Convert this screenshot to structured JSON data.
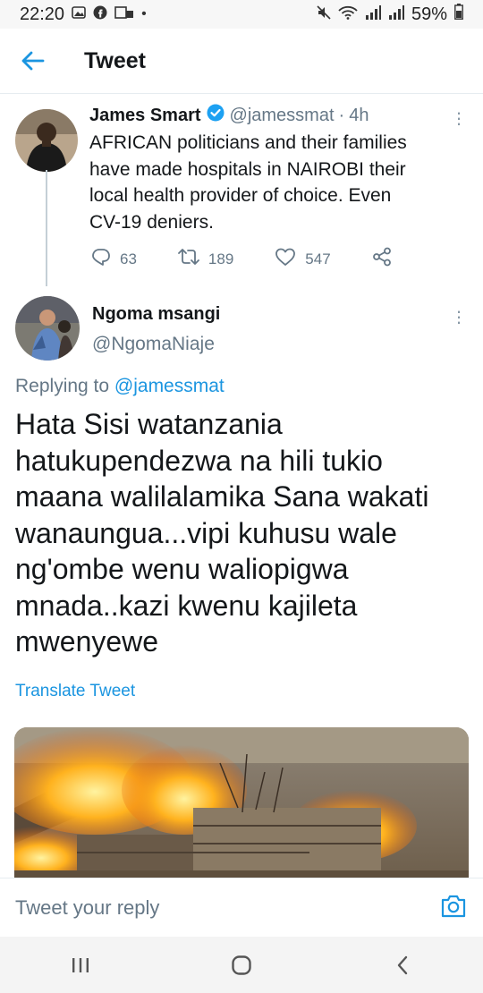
{
  "status_bar": {
    "time": "22:20",
    "battery": "59%",
    "left_icons": [
      "gallery-icon",
      "facebook-icon",
      "vpn-icon",
      "dot-icon"
    ],
    "right_icons": [
      "mute-icon",
      "wifi-icon",
      "signal-icon",
      "signal-icon",
      "battery-icon"
    ]
  },
  "header": {
    "title": "Tweet"
  },
  "tweet1": {
    "name": "James Smart",
    "handle": "@jamessmat",
    "separator": "·",
    "time": "4h",
    "text_lines": [
      "AFRICAN politicians and their families",
      "have made hospitals in NAIROBI their",
      "local health provider of choice. Even",
      "CV-19 deniers."
    ],
    "replies": "63",
    "retweets": "189",
    "likes": "547"
  },
  "tweet2": {
    "name": "Ngoma msangi",
    "handle": "@NgomaNiaje",
    "replying_prefix": "Replying to",
    "replying_handle": "@jamessmat",
    "text_lines": [
      "Hata Sisi watanzania",
      "hatukupendezwa na hili tukio",
      "maana walilalamika Sana wakati",
      "wanaungua...vipi kuhusu wale",
      "ng'ombe wenu waliopigwa",
      "mnada..kazi kwenu kajileta",
      "mwenyewe"
    ],
    "translate_label": "Translate Tweet"
  },
  "reply_bar": {
    "placeholder": "Tweet your reply"
  },
  "colors": {
    "accent": "#1b95e0",
    "secondary_text": "#657786",
    "primary_text": "#14171a"
  }
}
